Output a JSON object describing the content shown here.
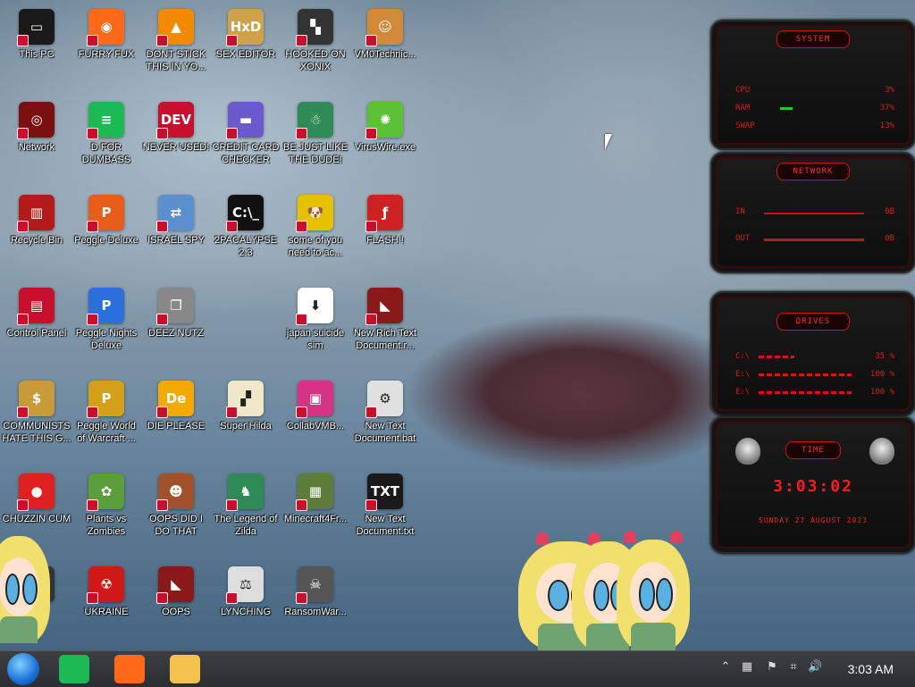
{
  "desktop": {
    "icons": [
      {
        "label": "This PC",
        "icon": "computer-icon",
        "color": "#1a1a1a",
        "glyph": "▭"
      },
      {
        "label": "FURRY FUX",
        "icon": "firefox-icon",
        "color": "#ff6a1a",
        "glyph": "◉"
      },
      {
        "label": "DONT STICK THIS IN YO...",
        "icon": "vlc-cone-icon",
        "color": "#f28a00",
        "glyph": "▲"
      },
      {
        "label": "SEX EDITOR",
        "icon": "hex-editor-icon",
        "color": "#cfa24a",
        "glyph": "HxD"
      },
      {
        "label": "HOOKED ON XONIX",
        "icon": "xonix-game-icon",
        "color": "#333333",
        "glyph": "▚"
      },
      {
        "label": "VM0Technic...",
        "icon": "technician-icon",
        "color": "#d28a3a",
        "glyph": "☺"
      },
      {
        "label": "Network",
        "icon": "network-icon",
        "color": "#7a1010",
        "glyph": "◎"
      },
      {
        "label": "D FOR DUMBASS",
        "icon": "notes-app-icon",
        "color": "#1db954",
        "glyph": "≡"
      },
      {
        "label": "NEVER USED!",
        "icon": "dev-cpp-icon",
        "color": "#c8102e",
        "glyph": "DEV"
      },
      {
        "label": "CREDIT CARD CHECKER",
        "icon": "credit-card-icon",
        "color": "#6a5acd",
        "glyph": "▬"
      },
      {
        "label": "BE JUST LIKE THE DUDE!",
        "icon": "santa-dude-icon",
        "color": "#2e8b57",
        "glyph": "☃"
      },
      {
        "label": "VirusWire.exe",
        "icon": "lime-wire-icon",
        "color": "#5bc236",
        "glyph": "✺"
      },
      {
        "label": "Recycle Bin",
        "icon": "recycle-bin-icon",
        "color": "#b51a1a",
        "glyph": "▥"
      },
      {
        "label": "Peggle Deluxe",
        "icon": "peggle-icon",
        "color": "#e85d1a",
        "glyph": "P"
      },
      {
        "label": "ISRAEL SPY",
        "icon": "spy-network-icon",
        "color": "#5a8fd0",
        "glyph": "⇄"
      },
      {
        "label": "2PACALYPSE 2.3",
        "icon": "terminal-icon",
        "color": "#111111",
        "glyph": "C:\\_"
      },
      {
        "label": "some of you need to ac...",
        "icon": "dog-icon",
        "color": "#e5c100",
        "glyph": "🐶"
      },
      {
        "label": "FLASH !",
        "icon": "flash-icon",
        "color": "#cc2222",
        "glyph": "ƒ"
      },
      {
        "label": "Control Panel",
        "icon": "control-panel-icon",
        "color": "#c8102e",
        "glyph": "▤"
      },
      {
        "label": "Peggle Nights Deluxe",
        "icon": "peggle-nights-icon",
        "color": "#2a6fdb",
        "glyph": "P"
      },
      {
        "label": "DEEZ NUTZ",
        "icon": "window-stack-icon",
        "color": "#888888",
        "glyph": "❐"
      },
      {
        "label": "",
        "icon": "blank-slot",
        "color": "transparent",
        "glyph": ""
      },
      {
        "label": "japan suicide sim",
        "icon": "japan-sim-icon",
        "color": "#ffffff",
        "glyph": "⬇"
      },
      {
        "label": "New Rich Text Document.r...",
        "icon": "rich-text-icon",
        "color": "#8a1a1a",
        "glyph": "◣"
      },
      {
        "label": "COMMUNISTS HATE THIS G...",
        "icon": "money-bag-icon",
        "color": "#c79a3a",
        "glyph": "$"
      },
      {
        "label": "Peggle World of Warcraft ...",
        "icon": "peggle-wow-icon",
        "color": "#d4a017",
        "glyph": "P"
      },
      {
        "label": "DIE PLEASE",
        "icon": "adobe-de-icon",
        "color": "#f2a900",
        "glyph": "De"
      },
      {
        "label": "Super Hilda",
        "icon": "pixel-cat-icon",
        "color": "#f0e6c8",
        "glyph": "▞"
      },
      {
        "label": "CollabVMB...",
        "icon": "virtualbox-icon",
        "color": "#d63384",
        "glyph": "▣"
      },
      {
        "label": "New Text Document.bat",
        "icon": "batch-file-icon",
        "color": "#e0e0e0",
        "glyph": "⚙"
      },
      {
        "label": "CHUZZIN CUM",
        "icon": "chuzzle-icon",
        "color": "#e02020",
        "glyph": "●"
      },
      {
        "label": "Plants vs Zombies",
        "icon": "pvz-icon",
        "color": "#5a9e3a",
        "glyph": "✿"
      },
      {
        "label": "OOPS DID I DO THAT",
        "icon": "portrait-icon",
        "color": "#a0522d",
        "glyph": "☻"
      },
      {
        "label": "The Legend of Zilda",
        "icon": "zelda-icon",
        "color": "#2e8b57",
        "glyph": "♞"
      },
      {
        "label": "Minecraft4Fr...",
        "icon": "minecraft-icon",
        "color": "#5d7c3a",
        "glyph": "▦"
      },
      {
        "label": "New Text Document.txt",
        "icon": "text-file-icon",
        "color": "#1a1a1a",
        "glyph": "TXT"
      },
      {
        "label": "",
        "icon": "partially-hidden-icon",
        "color": "#333333",
        "glyph": ""
      },
      {
        "label": "UKRAINE",
        "icon": "radiation-icon",
        "color": "#d01818",
        "glyph": "☢"
      },
      {
        "label": "OOPS",
        "icon": "oops-icon",
        "color": "#8a1a1a",
        "glyph": "◣"
      },
      {
        "label": "LYNCHING",
        "icon": "lynching-icon",
        "color": "#dddddd",
        "glyph": "⚖"
      },
      {
        "label": "RansomWar...",
        "icon": "skull-icon",
        "color": "#555555",
        "glyph": "☠"
      },
      {
        "label": "",
        "icon": "blank-slot",
        "color": "transparent",
        "glyph": ""
      }
    ]
  },
  "widgets": {
    "system": {
      "title": "SYSTEM",
      "rows": [
        {
          "label": "CPU",
          "value": "3%"
        },
        {
          "label": "RAM",
          "value": "37%"
        },
        {
          "label": "SWAP",
          "value": "13%"
        }
      ]
    },
    "network": {
      "title": "NETWORK",
      "rows": [
        {
          "label": "IN",
          "value": "0B"
        },
        {
          "label": "OUT",
          "value": "0B"
        }
      ]
    },
    "drives": {
      "title": "DRIVES",
      "rows": [
        {
          "label": "C:\\",
          "value": "35 %"
        },
        {
          "label": "E:\\",
          "value": "100 %"
        },
        {
          "label": "E:\\",
          "value": "100 %"
        }
      ]
    },
    "time": {
      "title": "TIME",
      "clock": "3:03:02",
      "date": "SUNDAY 27 AUGUST 2023"
    }
  },
  "taskbar": {
    "start_icon": "start-orb-icon",
    "pinned": [
      {
        "name": "notes-app-taskbar-icon",
        "color": "#1db954"
      },
      {
        "name": "firefox-taskbar-icon",
        "color": "#ff6a1a"
      },
      {
        "name": "file-explorer-taskbar-icon",
        "color": "#f2c14e"
      }
    ],
    "tray": [
      {
        "name": "chevron-up-icon",
        "glyph": "⌃"
      },
      {
        "name": "app-tray-icon",
        "glyph": "▦"
      },
      {
        "name": "flag-icon",
        "glyph": "⚑"
      },
      {
        "name": "network-tray-icon",
        "glyph": "⌗"
      },
      {
        "name": "volume-icon",
        "glyph": "🔊"
      }
    ],
    "clock": "3:03 AM"
  },
  "colors": {
    "accent_red": "#e01818",
    "taskbar_bg": "#2c2d30"
  }
}
